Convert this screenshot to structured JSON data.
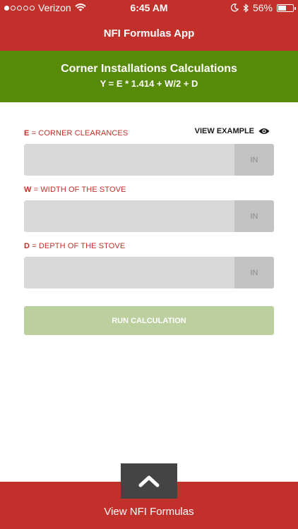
{
  "status_bar": {
    "carrier": "Verizon",
    "time": "6:45 AM",
    "battery": "56%",
    "battery_level": 0.56
  },
  "nav": {
    "title": "NFI Formulas App"
  },
  "header": {
    "title": "Corner Installations Calculations",
    "formula": "Y = E * 1.414 + W/2 + D"
  },
  "form": {
    "view_example": "VIEW EXAMPLE",
    "fields": [
      {
        "key": "E",
        "sep": " = ",
        "label": "CORNER CLEARANCES",
        "value": "",
        "unit": "IN"
      },
      {
        "key": "W",
        "sep": " = ",
        "label": "WIDTH OF THE STOVE",
        "value": "",
        "unit": "IN"
      },
      {
        "key": "D",
        "sep": " = ",
        "label": "DEPTH OF THE STOVE",
        "value": "",
        "unit": "IN"
      }
    ],
    "run_label": "RUN CALCULATION"
  },
  "footer": {
    "label": "View NFI Formulas"
  },
  "colors": {
    "brand_red": "#c1302a",
    "header_green": "#568a08",
    "run_button": "#bccf9e"
  }
}
